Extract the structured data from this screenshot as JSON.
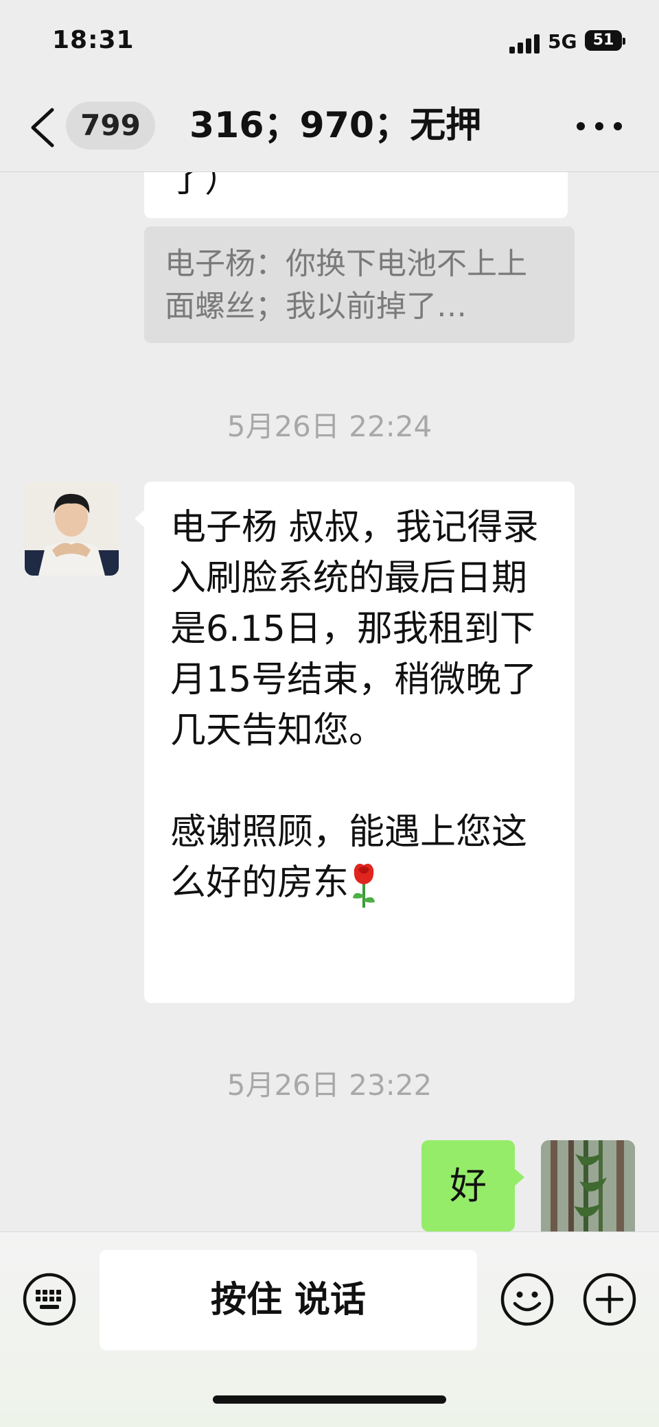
{
  "status_bar": {
    "time": "18:31",
    "network": "5G",
    "battery": "51"
  },
  "header": {
    "unread_count": "799",
    "title": "316；970；无押"
  },
  "messages": {
    "prev_fragment": "了）",
    "quote_text": "电子杨：你换下电池不上上面螺丝；我以前掉了…",
    "timestamp_1": "5月26日 22:24",
    "main_message": "电子杨 叔叔，我记得录入刷脸系统的最后日期是6.15日，那我租到下月15号结束，稍微晚了几天告知您。\n\n感谢照顾，能遇上您这么好的房东",
    "timestamp_2": "5月26日 23:22",
    "my_reply": "好"
  },
  "input_bar": {
    "hold_to_talk_label": "按住 说话"
  },
  "colors": {
    "background": "#ededed",
    "my_bubble": "#95ec69",
    "their_bubble": "#ffffff",
    "quote_bg": "#dedede"
  },
  "icons": [
    "back-chevron-icon",
    "more-dots-icon",
    "keyboard-icon",
    "emoji-icon",
    "plus-icon",
    "rose-icon"
  ]
}
